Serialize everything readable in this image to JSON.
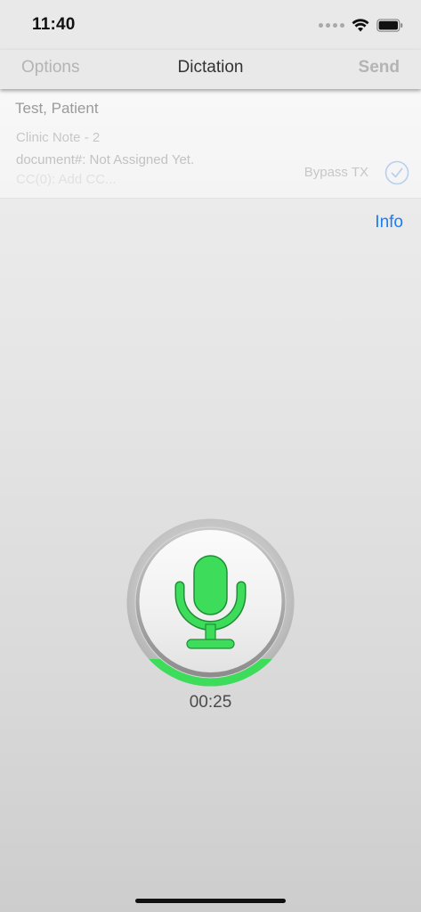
{
  "status_bar": {
    "time": "11:40",
    "icons": [
      "cellular-dots-icon",
      "wifi-icon",
      "battery-icon"
    ]
  },
  "nav": {
    "left_label": "Options",
    "title": "Dictation",
    "right_label": "Send"
  },
  "patient": {
    "name": "Test, Patient",
    "note_type": "Clinic Note - 2",
    "document_number": "document#: Not Assigned Yet.",
    "cc": "CC(0): Add CC...",
    "bypass_label": "Bypass TX",
    "bypass_icon": "checkmark-circle-icon"
  },
  "info_link": "Info",
  "recorder": {
    "icon": "microphone-icon",
    "elapsed": "00:25",
    "accent_color": "#3ddc5a"
  },
  "colors": {
    "link": "#1a7df0",
    "disabled_text": "#b4b4b4",
    "mic_green": "#3ddc5a"
  }
}
